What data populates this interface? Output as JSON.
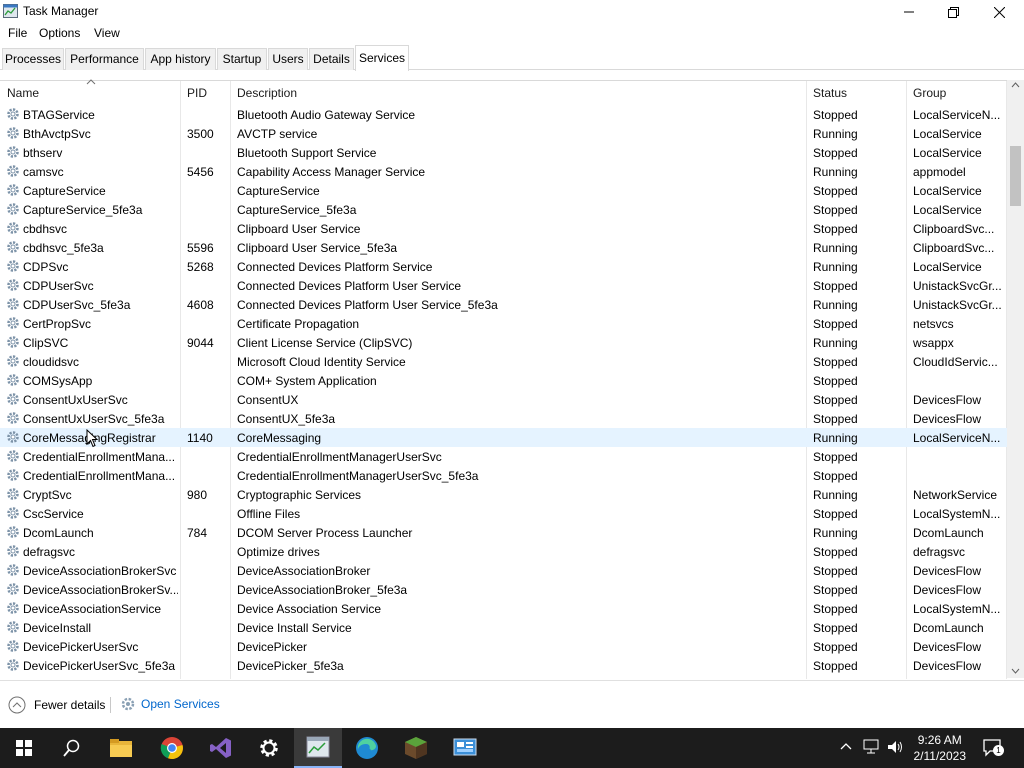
{
  "window": {
    "title": "Task Manager"
  },
  "menu": [
    "File",
    "Options",
    "View"
  ],
  "tabs": [
    "Processes",
    "Performance",
    "App history",
    "Startup",
    "Users",
    "Details",
    "Services"
  ],
  "active_tab": "Services",
  "columns": [
    "Name",
    "PID",
    "Description",
    "Status",
    "Group"
  ],
  "rows": [
    {
      "name": "BTAGService",
      "pid": "",
      "desc": "Bluetooth Audio Gateway Service",
      "status": "Stopped",
      "group": "LocalServiceN..."
    },
    {
      "name": "BthAvctpSvc",
      "pid": "3500",
      "desc": "AVCTP service",
      "status": "Running",
      "group": "LocalService"
    },
    {
      "name": "bthserv",
      "pid": "",
      "desc": "Bluetooth Support Service",
      "status": "Stopped",
      "group": "LocalService"
    },
    {
      "name": "camsvc",
      "pid": "5456",
      "desc": "Capability Access Manager Service",
      "status": "Running",
      "group": "appmodel"
    },
    {
      "name": "CaptureService",
      "pid": "",
      "desc": "CaptureService",
      "status": "Stopped",
      "group": "LocalService"
    },
    {
      "name": "CaptureService_5fe3a",
      "pid": "",
      "desc": "CaptureService_5fe3a",
      "status": "Stopped",
      "group": "LocalService"
    },
    {
      "name": "cbdhsvc",
      "pid": "",
      "desc": "Clipboard User Service",
      "status": "Stopped",
      "group": "ClipboardSvc..."
    },
    {
      "name": "cbdhsvc_5fe3a",
      "pid": "5596",
      "desc": "Clipboard User Service_5fe3a",
      "status": "Running",
      "group": "ClipboardSvc..."
    },
    {
      "name": "CDPSvc",
      "pid": "5268",
      "desc": "Connected Devices Platform Service",
      "status": "Running",
      "group": "LocalService"
    },
    {
      "name": "CDPUserSvc",
      "pid": "",
      "desc": "Connected Devices Platform User Service",
      "status": "Stopped",
      "group": "UnistackSvcGr..."
    },
    {
      "name": "CDPUserSvc_5fe3a",
      "pid": "4608",
      "desc": "Connected Devices Platform User Service_5fe3a",
      "status": "Running",
      "group": "UnistackSvcGr..."
    },
    {
      "name": "CertPropSvc",
      "pid": "",
      "desc": "Certificate Propagation",
      "status": "Stopped",
      "group": "netsvcs"
    },
    {
      "name": "ClipSVC",
      "pid": "9044",
      "desc": "Client License Service (ClipSVC)",
      "status": "Running",
      "group": "wsappx"
    },
    {
      "name": "cloudidsvc",
      "pid": "",
      "desc": "Microsoft Cloud Identity Service",
      "status": "Stopped",
      "group": "CloudIdServic..."
    },
    {
      "name": "COMSysApp",
      "pid": "",
      "desc": "COM+ System Application",
      "status": "Stopped",
      "group": ""
    },
    {
      "name": "ConsentUxUserSvc",
      "pid": "",
      "desc": "ConsentUX",
      "status": "Stopped",
      "group": "DevicesFlow"
    },
    {
      "name": "ConsentUxUserSvc_5fe3a",
      "pid": "",
      "desc": "ConsentUX_5fe3a",
      "status": "Stopped",
      "group": "DevicesFlow"
    },
    {
      "name": "CoreMessagingRegistrar",
      "pid": "1140",
      "desc": "CoreMessaging",
      "status": "Running",
      "group": "LocalServiceN..."
    },
    {
      "name": "CredentialEnrollmentMana...",
      "pid": "",
      "desc": "CredentialEnrollmentManagerUserSvc",
      "status": "Stopped",
      "group": ""
    },
    {
      "name": "CredentialEnrollmentMana...",
      "pid": "",
      "desc": "CredentialEnrollmentManagerUserSvc_5fe3a",
      "status": "Stopped",
      "group": ""
    },
    {
      "name": "CryptSvc",
      "pid": "980",
      "desc": "Cryptographic Services",
      "status": "Running",
      "group": "NetworkService"
    },
    {
      "name": "CscService",
      "pid": "",
      "desc": "Offline Files",
      "status": "Stopped",
      "group": "LocalSystemN..."
    },
    {
      "name": "DcomLaunch",
      "pid": "784",
      "desc": "DCOM Server Process Launcher",
      "status": "Running",
      "group": "DcomLaunch"
    },
    {
      "name": "defragsvc",
      "pid": "",
      "desc": "Optimize drives",
      "status": "Stopped",
      "group": "defragsvc"
    },
    {
      "name": "DeviceAssociationBrokerSvc",
      "pid": "",
      "desc": "DeviceAssociationBroker",
      "status": "Stopped",
      "group": "DevicesFlow"
    },
    {
      "name": "DeviceAssociationBrokerSv...",
      "pid": "",
      "desc": "DeviceAssociationBroker_5fe3a",
      "status": "Stopped",
      "group": "DevicesFlow"
    },
    {
      "name": "DeviceAssociationService",
      "pid": "",
      "desc": "Device Association Service",
      "status": "Stopped",
      "group": "LocalSystemN..."
    },
    {
      "name": "DeviceInstall",
      "pid": "",
      "desc": "Device Install Service",
      "status": "Stopped",
      "group": "DcomLaunch"
    },
    {
      "name": "DevicePickerUserSvc",
      "pid": "",
      "desc": "DevicePicker",
      "status": "Stopped",
      "group": "DevicesFlow"
    },
    {
      "name": "DevicePickerUserSvc_5fe3a",
      "pid": "",
      "desc": "DevicePicker_5fe3a",
      "status": "Stopped",
      "group": "DevicesFlow"
    }
  ],
  "highlighted_row": 17,
  "footer": {
    "fewer_details": "Fewer details",
    "open_services": "Open Services"
  },
  "taskbar": {
    "time": "9:26 AM",
    "date": "2/11/2023",
    "notification_count": "1",
    "apps": [
      "start-icon",
      "search-icon",
      "file-explorer-icon",
      "chrome-icon",
      "visual-studio-icon",
      "settings-icon",
      "task-manager-icon",
      "edge-icon",
      "minecraft-icon",
      "control-panel-icon"
    ]
  },
  "colors": {
    "accent": "#0066cc",
    "highlight": "#e5f3ff",
    "taskbar": "#1c1c1c"
  }
}
